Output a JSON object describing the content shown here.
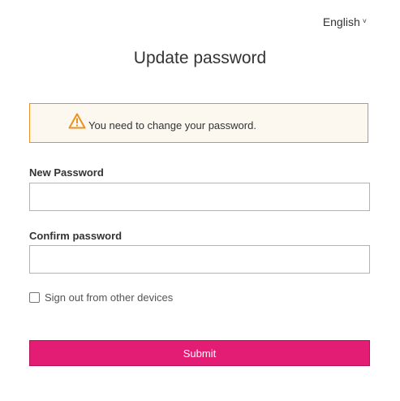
{
  "header": {
    "language": "English",
    "language_chevron": "˅"
  },
  "page": {
    "title": "Update password"
  },
  "alert": {
    "icon": "warning-triangle-icon",
    "message": "You need to change your password.",
    "border_color": "#ec9020",
    "background_color": "#fcf8f0"
  },
  "form": {
    "new_password_label": "New Password",
    "new_password_value": "",
    "confirm_password_label": "Confirm password",
    "confirm_password_value": "",
    "sign_out_label": "Sign out from other devices",
    "sign_out_checked": false,
    "submit_label": "Submit"
  },
  "colors": {
    "accent": "#e21d73",
    "text": "#333333"
  }
}
